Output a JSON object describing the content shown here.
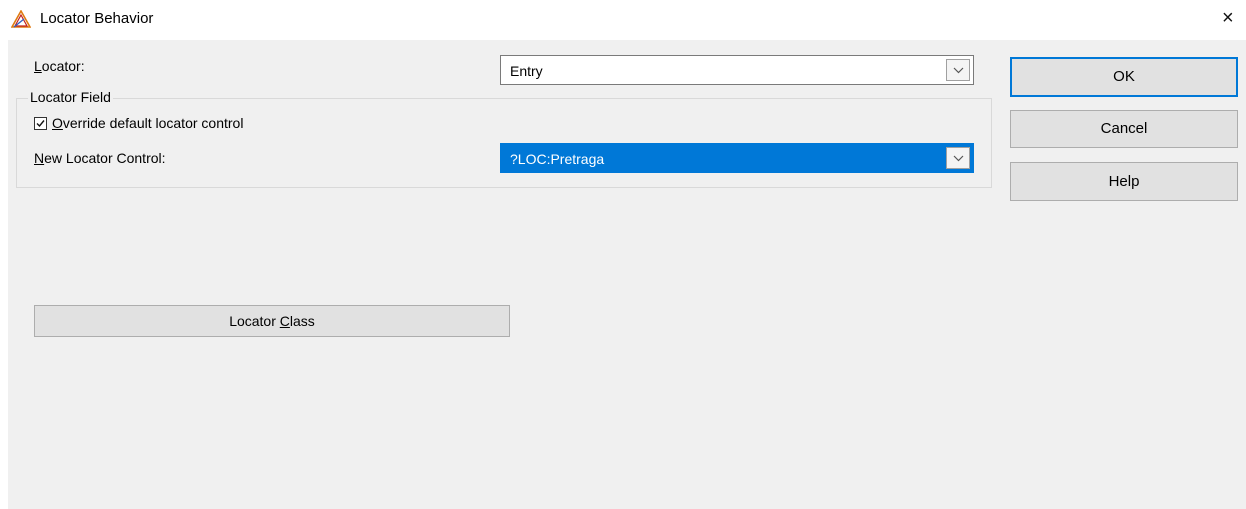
{
  "window": {
    "title": "Locator Behavior",
    "close_symbol": "×"
  },
  "icons": {
    "app": "triangle-logo-icon",
    "close": "close-icon",
    "dropdown": "chevron-down-icon",
    "checkbox": "checkmark-icon"
  },
  "form": {
    "locator_label_hotkey": "L",
    "locator_label_rest": "ocator:",
    "locator_value": "Entry",
    "group_title": "Locator Field",
    "override_label_hotkey": "O",
    "override_label_rest": "verride default locator control",
    "override_checked": true,
    "new_control_label_hotkey": "N",
    "new_control_label_rest": "ew Locator Control:",
    "new_control_value": "?LOC:Pretraga",
    "locator_class_before": "Locator ",
    "locator_class_hotkey": "C",
    "locator_class_after": "lass"
  },
  "buttons": {
    "ok": "OK",
    "cancel": "Cancel",
    "help": "Help"
  },
  "colors": {
    "selection": "#0078d7",
    "dialog_bg": "#f0f0f0",
    "button_bg": "#e1e1e1"
  }
}
